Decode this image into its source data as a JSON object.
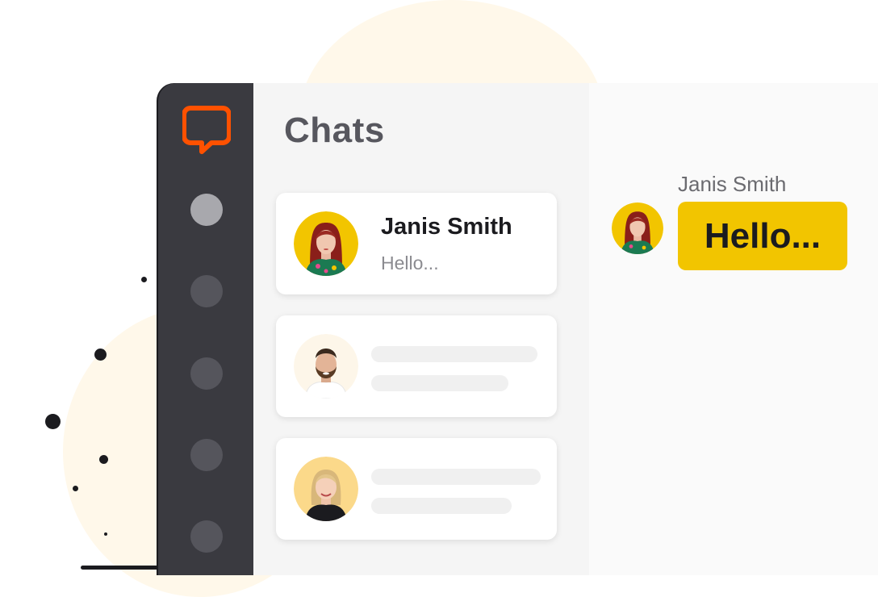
{
  "colors": {
    "sidebar": "#3a3a40",
    "brand_orange": "#ff5100",
    "bubble_yellow": "#f2c500",
    "list_bg": "#f5f5f5"
  },
  "sidebar": {
    "logo": "livechat-logo-icon",
    "nav_items": [
      {
        "icon": "nav-dot-icon",
        "active": true
      },
      {
        "icon": "nav-dot-icon",
        "active": false
      },
      {
        "icon": "nav-dot-icon",
        "active": false
      },
      {
        "icon": "nav-dot-icon",
        "active": false
      },
      {
        "icon": "nav-dot-icon",
        "active": false
      }
    ]
  },
  "chat_list": {
    "title": "Chats",
    "chats": [
      {
        "name": "Janis Smith",
        "preview": "Hello...",
        "avatar": "woman-red-hair-avatar"
      },
      {
        "name": "",
        "preview": "",
        "avatar": "man-beard-avatar"
      },
      {
        "name": "",
        "preview": "",
        "avatar": "woman-blonde-avatar"
      }
    ]
  },
  "conversation": {
    "sender": "Janis Smith",
    "message": "Hello..."
  }
}
